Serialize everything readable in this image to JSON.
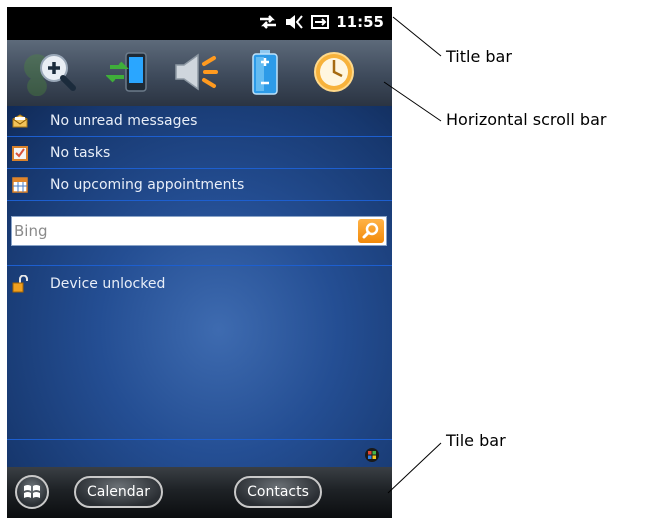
{
  "status_bar": {
    "time": "11:55",
    "icons": [
      "connectivity-arrows-icon",
      "speaker-muted-icon",
      "battery-charging-icon"
    ]
  },
  "scroll_bar": {
    "items": [
      {
        "name": "zoom-icon"
      },
      {
        "name": "device-connection-icon"
      },
      {
        "name": "volume-icon"
      },
      {
        "name": "battery-icon"
      },
      {
        "name": "clock-icon"
      }
    ]
  },
  "home": {
    "messages": "No unread messages",
    "tasks": "No tasks",
    "appointments": "No upcoming appointments",
    "search_placeholder": "Bing",
    "lock_status": "Device unlocked"
  },
  "tile_bar": {
    "calendar_label": "Calendar",
    "contacts_label": "Contacts"
  },
  "annotations": {
    "title_bar": "Title bar",
    "scroll_bar": "Horizontal scroll bar",
    "tile_bar": "Tile bar"
  },
  "colors": {
    "home_background": "#244e93",
    "row_divider": "#1d5fd0",
    "search_button": "#f28a0a",
    "title_bar": "#000000"
  }
}
